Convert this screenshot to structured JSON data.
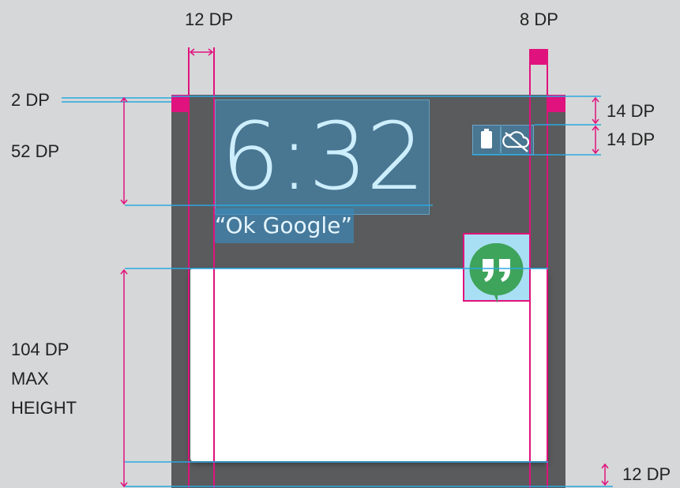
{
  "watch": {
    "time": "6:32",
    "hotword": "“Ok Google”"
  },
  "icons": {
    "battery": "battery-icon",
    "cloud_off": "cloud-off-icon",
    "app": "hangouts-quote-icon"
  },
  "annotations": {
    "gutter_left": "12 DP",
    "gutter_right": "8 DP",
    "top_bar": "2 DP",
    "clock_height": "52 DP",
    "status_top": "14 DP",
    "status_height": "14 DP",
    "card_height": [
      "104 DP",
      "MAX",
      "HEIGHT"
    ],
    "card_bottom": "12 DP"
  },
  "colors": {
    "background": "#d6d7d8",
    "device": "#5a5b5c",
    "guide_magenta": "#e0127d",
    "guide_cyan": "#2aa8e0",
    "highlight_blue": "#3c8cbe",
    "clock_text": "#cdeefc",
    "card": "#ffffff",
    "hangouts_green": "#3ea45b"
  }
}
